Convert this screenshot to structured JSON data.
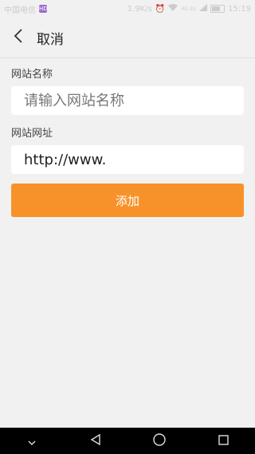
{
  "status_bar": {
    "carrier": "中国电信",
    "carrier_badge": "HD",
    "net_speed": "1.9K/s",
    "network": "4G 2G",
    "time": "15:19"
  },
  "header": {
    "back_icon": "chevron-left-icon",
    "title": "取消"
  },
  "form": {
    "name_label": "网站名称",
    "name_placeholder": "请输入网站名称",
    "url_label": "网站网址",
    "url_value": "http://www.",
    "add_button": "添加",
    "accent_color": "#f7922a"
  },
  "nav_bar": {
    "icons": [
      "chevron-down-icon",
      "back-triangle-icon",
      "home-circle-icon",
      "recents-square-icon"
    ]
  }
}
